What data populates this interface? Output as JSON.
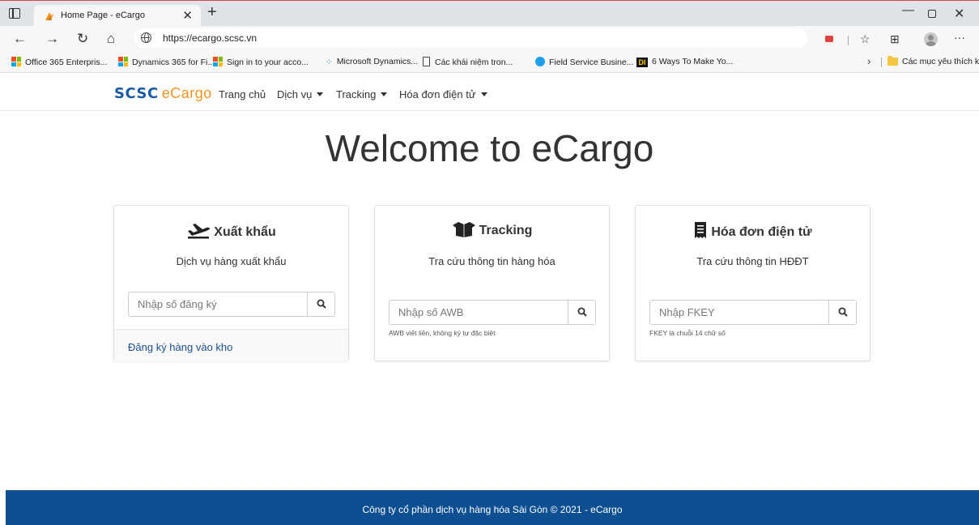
{
  "browser": {
    "tab_title": "Home Page - eCargo",
    "tab_close": "✕",
    "new_tab": "+",
    "url": "https://ecargo.scsc.vn",
    "window": {
      "minimize": "—",
      "close": "✕"
    },
    "nav": {
      "back": "←",
      "forward": "→",
      "refresh": "↻",
      "home": "⌂"
    },
    "toolbar_icons": {
      "favorites": "☆",
      "collections": "⊞",
      "more": "···"
    },
    "bookmarks": [
      {
        "label": "Office 365 Enterpris...",
        "icon": "microsoft-logo-icon"
      },
      {
        "label": "Dynamics 365 for Fi...",
        "icon": "microsoft-logo-icon"
      },
      {
        "label": "Sign in to your acco...",
        "icon": "microsoft-logo-icon"
      },
      {
        "label": "Microsoft Dynamics...",
        "icon": "dynamics-icon"
      },
      {
        "label": "Các khái niệm tron...",
        "icon": "page-icon"
      },
      {
        "label": "Field Service Busine...",
        "icon": "field-service-icon"
      },
      {
        "label": "6 Ways To Make Yo...",
        "icon": "di-icon"
      }
    ],
    "bookmark_chevron": "›",
    "other_favorites": "Các mục yêu thích khác"
  },
  "site": {
    "brand_scsc": "SCSC",
    "brand_ecargo": "eCargo",
    "nav": {
      "home": "Trang chủ",
      "services": "Dịch vụ",
      "tracking": "Tracking",
      "einvoice": "Hóa đơn điện tử"
    },
    "welcome": "Welcome to eCargo",
    "cards": {
      "export": {
        "title": "Xuất khẩu",
        "subtitle": "Dịch vụ hàng xuất khẩu",
        "placeholder": "Nhập số đăng ký",
        "footer_link": "Đăng ký hàng vào kho"
      },
      "tracking": {
        "title": "Tracking",
        "subtitle": "Tra cứu thông tin hàng hóa",
        "placeholder": "Nhập số AWB",
        "help": "AWB viết liền, không ký tự đặc biệt"
      },
      "einvoice": {
        "title": "Hóa đơn điện tử",
        "subtitle": "Tra cứu thông tin HĐĐT",
        "placeholder": "Nhập FKEY",
        "help": "FKEY là chuỗi 14 chữ số"
      }
    },
    "footer": "Công ty cổ phần dịch vụ hàng hóa Sài Gòn © 2021 - eCargo"
  },
  "colors": {
    "brand_blue": "#1a5aa6",
    "brand_orange": "#f29222",
    "footer_bg": "#0e4f92",
    "link": "#1a4f8f"
  }
}
